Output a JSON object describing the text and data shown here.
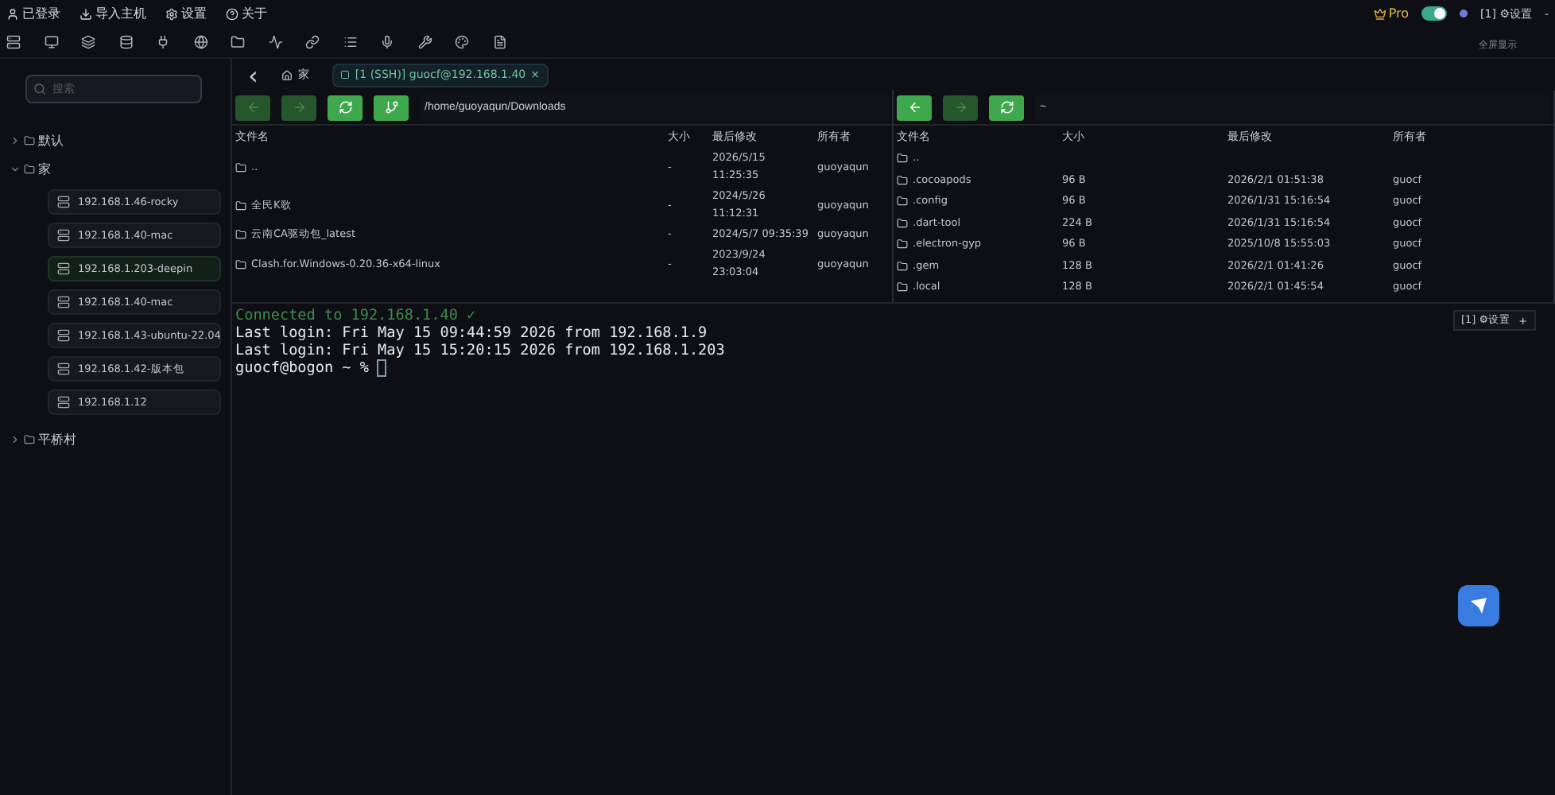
{
  "menu": [
    "已登录",
    "导入主机",
    "设置",
    "关于"
  ],
  "top_right": {
    "pro_label": "Pro",
    "toggle_on": true,
    "session_label": "[1] ⚙设置",
    "minimize": "-",
    "fullscreen_label": "全屏显示"
  },
  "sidebar": {
    "search_placeholder": "搜索",
    "groups": [
      {
        "name": "默认",
        "expanded": false
      },
      {
        "name": "家",
        "expanded": true,
        "children": [
          {
            "label": "192.168.1.46-rocky",
            "selected": false
          },
          {
            "label": "192.168.1.40-mac",
            "selected": false
          },
          {
            "label": "192.168.1.203-deepin",
            "selected": true
          },
          {
            "label": "192.168.1.40-mac",
            "selected": false
          },
          {
            "label": "192.168.1.43-ubuntu-22.04",
            "selected": false
          },
          {
            "label": "192.168.1.42-版本包",
            "selected": false
          },
          {
            "label": "192.168.1.12",
            "selected": false
          }
        ]
      },
      {
        "name": "平桥村",
        "expanded": false
      }
    ]
  },
  "tabs": {
    "back": "‹",
    "items": [
      {
        "label": "家",
        "kind": "home",
        "selected": false
      },
      {
        "label": "[1 (SSH)] guocf@192.168.1.40",
        "kind": "session",
        "selected": true,
        "close": "×"
      }
    ]
  },
  "local_pane": {
    "buttons": [
      {
        "kind": "back",
        "enabled": false
      },
      {
        "kind": "forward",
        "enabled": false
      },
      {
        "kind": "refresh",
        "enabled": true
      },
      {
        "kind": "tree",
        "enabled": true
      }
    ],
    "path": "/home/guoyaqun/Downloads",
    "columns": [
      "文件名",
      "大小",
      "最后修改",
      "所有者"
    ],
    "rows": [
      [
        "..",
        "-",
        "2026/5/15 11:25:35",
        "guoyaqun"
      ],
      [
        "全民K歌",
        "-",
        "2024/5/26 11:12:31",
        "guoyaqun"
      ],
      [
        "云南CA驱动包_latest",
        "-",
        "2024/5/7 09:35:39",
        "guoyaqun"
      ],
      [
        "Clash.for.Windows-0.20.36-x64-linux",
        "-",
        "2023/9/24 23:03:04",
        "guoyaqun"
      ]
    ]
  },
  "remote_pane": {
    "buttons": [
      {
        "kind": "back",
        "enabled": true
      },
      {
        "kind": "forward",
        "enabled": false
      },
      {
        "kind": "refresh",
        "enabled": true
      }
    ],
    "path": "~",
    "columns": [
      "文件名",
      "大小",
      "最后修改",
      "所有者"
    ],
    "rows": [
      [
        "..",
        "",
        "",
        ""
      ],
      [
        ".cocoapods",
        "96 B",
        "2026/2/1 01:51:38",
        "guocf"
      ],
      [
        ".config",
        "96 B",
        "2026/1/31 15:16:54",
        "guocf"
      ],
      [
        ".dart-tool",
        "224 B",
        "2026/1/31 15:16:54",
        "guocf"
      ],
      [
        ".electron-gyp",
        "96 B",
        "2025/10/8 15:55:03",
        "guocf"
      ],
      [
        ".gem",
        "128 B",
        "2026/2/1 01:41:26",
        "guocf"
      ],
      [
        ".local",
        "128 B",
        "2026/2/1 01:45:54",
        "guocf"
      ]
    ]
  },
  "terminal": {
    "lines": [
      {
        "kind": "status",
        "text": "Connected to 192.168.1.40 ✓"
      },
      {
        "kind": "output",
        "text": "Last login: Fri May 15 09:44:59 2026 from 192.168.1.9"
      },
      {
        "kind": "output",
        "text": "Last login: Fri May 15 15:20:15 2026 from 192.168.1.203"
      },
      {
        "kind": "prompt",
        "text": "guocf@bogon ~ %"
      }
    ]
  },
  "floating_session": {
    "label": "[1] ⚙设置",
    "add": "+"
  }
}
